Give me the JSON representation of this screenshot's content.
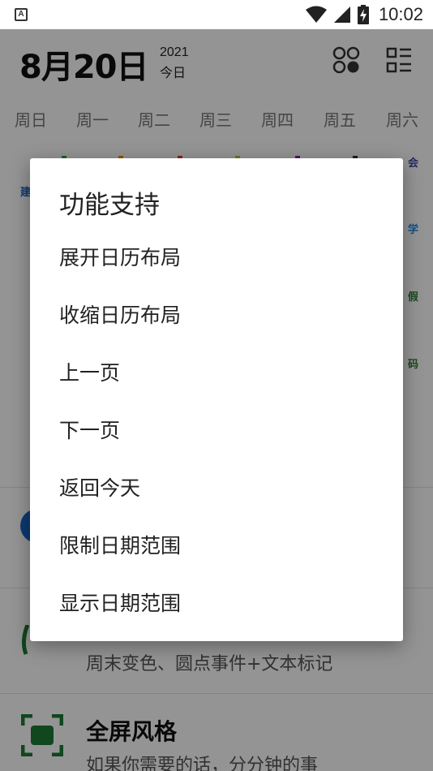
{
  "status_bar": {
    "time": "10:02",
    "app_icon_letter": "A",
    "icons": [
      "wifi-icon",
      "signal-icon",
      "battery-charging-icon"
    ]
  },
  "header": {
    "date": "8月20日",
    "year": "2021",
    "today_label": "今日",
    "icons": [
      "layout-grid-icon",
      "list-view-icon"
    ]
  },
  "weekdays": [
    "周日",
    "周一",
    "周二",
    "周三",
    "周四",
    "周五",
    "周六"
  ],
  "calendar_marks": {
    "left_col": [
      "建"
    ],
    "right_col": [
      "会",
      "学",
      "假",
      "码"
    ]
  },
  "lower_list": {
    "row1_subtitle": "周末变色、圆点事件+文本标记",
    "row2_title": "全屏风格",
    "row2_subtitle": "如果你需要的话，分分钟的事",
    "colors": {
      "accent_green": "#1c7a34",
      "accent_blue": "#1565c0"
    }
  },
  "dialog": {
    "title": "功能支持",
    "items": [
      "展开日历布局",
      "收缩日历布局",
      "上一页",
      "下一页",
      "返回今天",
      "限制日期范围",
      "显示日期范围"
    ]
  }
}
